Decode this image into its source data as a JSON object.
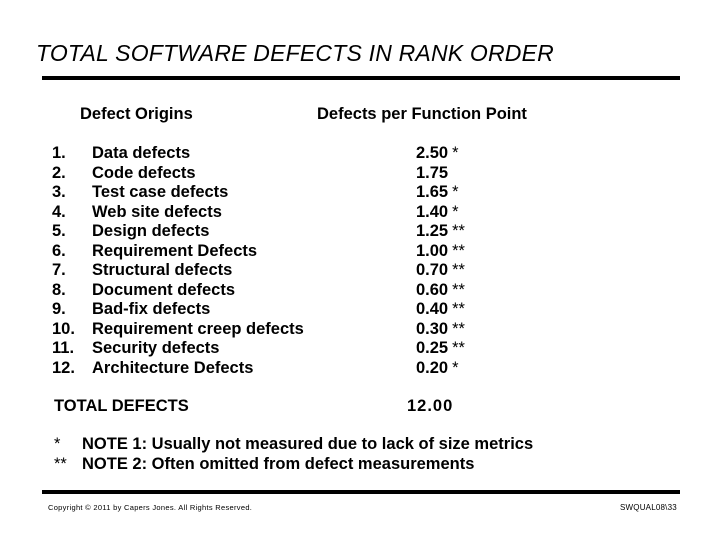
{
  "title": "TOTAL SOFTWARE DEFECTS IN RANK ORDER",
  "headers": {
    "origins": "Defect Origins",
    "per_fp": "Defects per Function Point"
  },
  "defects": [
    {
      "rank": "1.",
      "name": "Data defects",
      "value": "2.50",
      "note": "*"
    },
    {
      "rank": "2.",
      "name": "Code defects",
      "value": "1.75",
      "note": ""
    },
    {
      "rank": "3.",
      "name": "Test case defects",
      "value": "1.65",
      "note": "*"
    },
    {
      "rank": "4.",
      "name": "Web site defects",
      "value": "1.40",
      "note": "*"
    },
    {
      "rank": "5.",
      "name": "Design defects",
      "value": "1.25",
      "note": "**"
    },
    {
      "rank": "6.",
      "name": "Requirement Defects",
      "value": "1.00",
      "note": "**"
    },
    {
      "rank": "7.",
      "name": "Structural defects",
      "value": "0.70",
      "note": "**"
    },
    {
      "rank": "8.",
      "name": "Document defects",
      "value": "0.60",
      "note": "**"
    },
    {
      "rank": "9.",
      "name": "Bad-fix defects",
      "value": "0.40",
      "note": "**"
    },
    {
      "rank": "10.",
      "name": "Requirement creep defects",
      "value": "0.30",
      "note": "**"
    },
    {
      "rank": "11.",
      "name": "Security defects",
      "value": "0.25",
      "note": "**"
    },
    {
      "rank": "12.",
      "name": "Architecture Defects",
      "value": "0.20",
      "note": "*"
    }
  ],
  "total": {
    "label": "TOTAL DEFECTS",
    "value": "12.00"
  },
  "footnotes": [
    {
      "mark": "*",
      "text": "NOTE 1:  Usually not measured due to lack of size metrics"
    },
    {
      "mark": "**",
      "text": "NOTE 2:  Often omitted from defect measurements"
    }
  ],
  "footer": {
    "copyright": "Copyright © 2011 by Capers Jones. All Rights Reserved.",
    "slide_id": "SWQUAL08\\33"
  }
}
